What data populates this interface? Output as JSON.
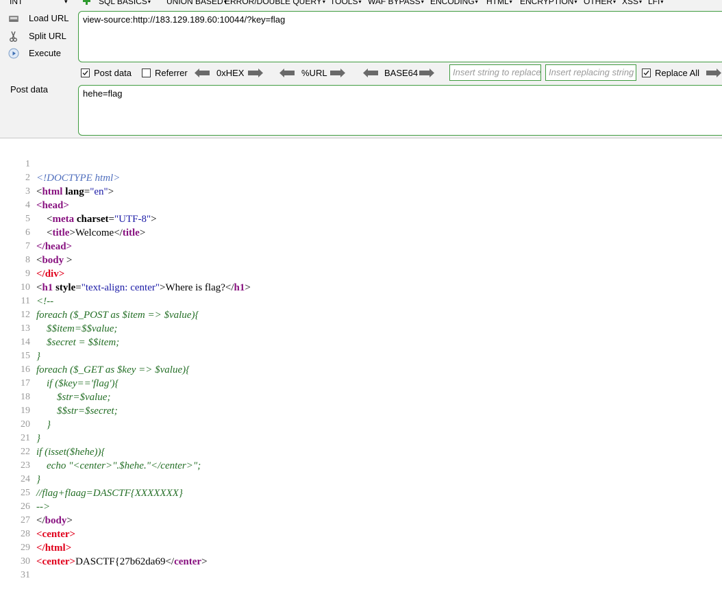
{
  "menu": {
    "int_select": "INT",
    "items": [
      "SQL BASICS",
      "UNION BASED",
      "ERROR/DOUBLE QUERY",
      "TOOLS",
      "WAF BYPASS",
      "ENCODING",
      "HTML",
      "ENCRYPTION",
      "OTHER",
      "XSS",
      "LFI"
    ]
  },
  "side": {
    "load_url": "Load URL",
    "split_url": "Split URL",
    "execute": "Execute"
  },
  "url_field": {
    "value": "view-source:http://183.129.189.60:10044/?key=flag"
  },
  "options": {
    "post_data": {
      "label": "Post data",
      "checked": true
    },
    "referrer": {
      "label": "Referrer",
      "checked": false
    },
    "hex": "0xHEX",
    "url": "%URL",
    "base64": "BASE64",
    "replace_placeholder": "Insert string to replace",
    "replacing_placeholder": "Insert replacing string",
    "replace_all": {
      "label": "Replace All",
      "checked": true
    }
  },
  "post": {
    "label": "Post data",
    "value": "hehe=flag"
  },
  "source": {
    "line_numbers": [
      "1",
      "2",
      "3",
      "4",
      "5",
      "6",
      "7",
      "8",
      "9",
      "10",
      "11",
      "12",
      "13",
      "14",
      "15",
      "16",
      "17",
      "18",
      "19",
      "20",
      "21",
      "22",
      "23",
      "24",
      "25",
      "26",
      "27",
      "28",
      "29",
      "30",
      "31"
    ],
    "l1_doctype": "<!DOCTYPE html>",
    "l2_lt": "<",
    "l2_tag": "html",
    "l2_attr": " lang",
    "l2_eq": "=",
    "l2_val": "\"en\"",
    "l2_gt": ">",
    "l3": "<head>",
    "l4_lt": "    <",
    "l4_tag": "meta",
    "l4_attr": " charset",
    "l4_eq": "=",
    "l4_val": "\"UTF-8\"",
    "l4_gt": ">",
    "l5_lt": "    <",
    "l5_tag": "title",
    "l5_gt": ">",
    "l5_text": "Welcome",
    "l5_lt2": "</",
    "l5_tag2": "title",
    "l5_gt2": ">",
    "l6": "</head>",
    "l7_lt": "<",
    "l7_tag": "body",
    "l7_gt": " >",
    "l8": "</div>",
    "l9_lt": "<",
    "l9_tag": "h1",
    "l9_attr": " style",
    "l9_eq": "=",
    "l9_val": "\"text-align: center\"",
    "l9_gt": ">",
    "l9_text": "Where is flag?",
    "l9_lt2": "</",
    "l9_tag2": "h1",
    "l9_gt2": ">",
    "l10": "<!--",
    "l11": "foreach ($_POST as $item => $value){",
    "l12": "    $$item=$$value;",
    "l13": "    $secret = $$item;",
    "l14": "}",
    "l15": "foreach ($_GET as $key => $value){",
    "l16": "    if ($key=='flag'){",
    "l17": "        $str=$value;",
    "l18": "        $$str=$secret;",
    "l19": "    }",
    "l20": "}",
    "l21": "if (isset($hehe)){",
    "l22": "    echo \"<center>\".$hehe.\"</center>\";",
    "l23": "}",
    "l24": "//flag+flaag=DASCTF{XXXXXXX}",
    "l25": "-->",
    "l26_lt": "</",
    "l26_tag": "body",
    "l26_gt": ">",
    "l27": "<center>",
    "l28": "</html>",
    "l29_open": "<center>",
    "l29_text": "DASCTF{27b62da69",
    "l29_lt": "</",
    "l29_tag": "center",
    "l29_gt": ">"
  },
  "colors": {
    "field_border": "#3f9b3f",
    "tag": "#881280",
    "tag_error": "#e0001b",
    "attr_value": "#1a1aa6",
    "comment": "#236e25",
    "line_number": "#9a9a9a"
  }
}
